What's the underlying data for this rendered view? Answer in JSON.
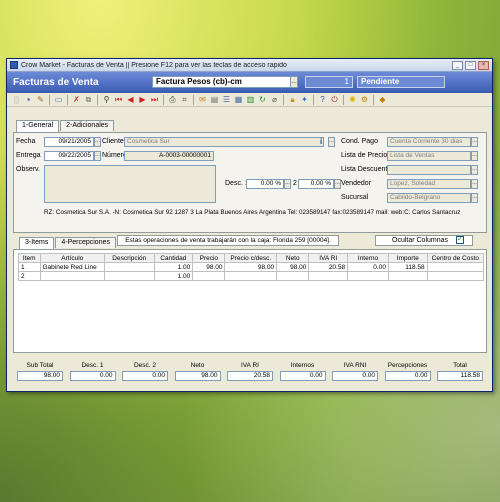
{
  "window": {
    "title": "Crow Market - Facturas de Venta || Presione F12 para ver las teclas de acceso rapido"
  },
  "header": {
    "form_title": "Facturas de Venta",
    "doc_type": "Factura Pesos (cb)-cm",
    "doc_number": "1",
    "doc_status": "Pendiente"
  },
  "tabs": {
    "general": "1-General",
    "adicionales": "2-Adicionales"
  },
  "general": {
    "fecha_label": "Fecha",
    "fecha": "09/21/2005",
    "entrega_label": "Entrega",
    "entrega": "09/22/2005",
    "cliente_label": "Cliente",
    "cliente": "Cosmetica Sur",
    "numero_label": "Número",
    "numero": "A-0003-00000001",
    "observ_label": "Observ.",
    "desc1_label": "Desc. 1",
    "desc1": "0.00 %",
    "desc2_label": "2",
    "desc2": "0.00 %",
    "cond_pago_label": "Cond. Pago",
    "cond_pago": "Cuenta Corriente 30 dias",
    "lista_precios_label": "Lista de Precios",
    "lista_precios": "Lista de Ventas",
    "lista_descuento_label": "Lista Descuento",
    "lista_descuento": "",
    "vendedor_label": "Vendedor",
    "vendedor": "Lopez, Soledad",
    "sucursal_label": "Sucursal",
    "sucursal": "Cabildo-Belgrano",
    "rz_line": "RZ: Cosmetica Sur S.A. -N: Cosmetica Sur 92 1287 3  La Plata Buenos Aires Argentina Tel: 023589147 fax:023589147 mail:  web:C: Carlos Santacruz"
  },
  "items_tabs": {
    "items": "3-Items",
    "percepciones": "4-Percepciones"
  },
  "items_info": "Estas operaciones de venta trabajarán con la caja: Florida 259 [00004].",
  "ocultar_columnas": "Ocultar Columnas",
  "grid": {
    "headers": [
      "Item",
      "Artículo",
      "Descripción",
      "Cantidad",
      "Precio",
      "Precio c/desc.",
      "Neto",
      "IVA RI",
      "Interno",
      "Importe",
      "Centro de Costo"
    ],
    "rows": [
      [
        "1",
        "Gabinete Red Line",
        "",
        "1.00",
        "98.00",
        "98.00",
        "98.00",
        "20.58",
        "0.00",
        "118.58",
        ""
      ],
      [
        "2",
        "",
        "",
        "1.00",
        "",
        "",
        "",
        "",
        "",
        "",
        ""
      ]
    ]
  },
  "totals": {
    "labels": [
      "Sub Total",
      "Desc. 1",
      "Desc. 2",
      "Neto",
      "IVA RI",
      "Internos",
      "IVA RNI",
      "Percepciones",
      "Total"
    ],
    "values": [
      "98.00",
      "0.00",
      "0.00",
      "98.00",
      "20.58",
      "0.00",
      "0.00",
      "0.00",
      "118.58"
    ]
  }
}
